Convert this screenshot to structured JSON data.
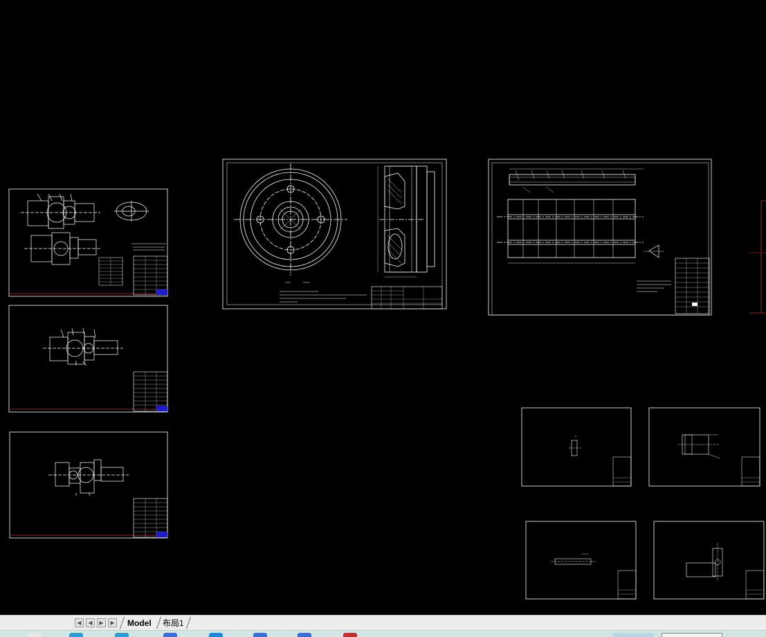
{
  "window": {
    "title": "Model"
  },
  "layout_tabs": [
    {
      "label": "Model",
      "active": true
    },
    {
      "label": "布局1",
      "active": false
    }
  ],
  "nav_buttons": [
    "first-layout",
    "previous-layout",
    "next-layout",
    "last-layout"
  ],
  "colors": {
    "modelspace_background": "#000000",
    "linework": "#ffffff",
    "titleblock_accent": "#1e1ecc",
    "border_red": "#c03030",
    "taskbar": "#d2e6e6"
  },
  "taskbar": {
    "icons": [
      "app-icon-1",
      "app-icon-2",
      "app-icon-3",
      "app-icon-4",
      "app-icon-5",
      "app-icon-6",
      "app-icon-7",
      "app-icon-8"
    ]
  }
}
